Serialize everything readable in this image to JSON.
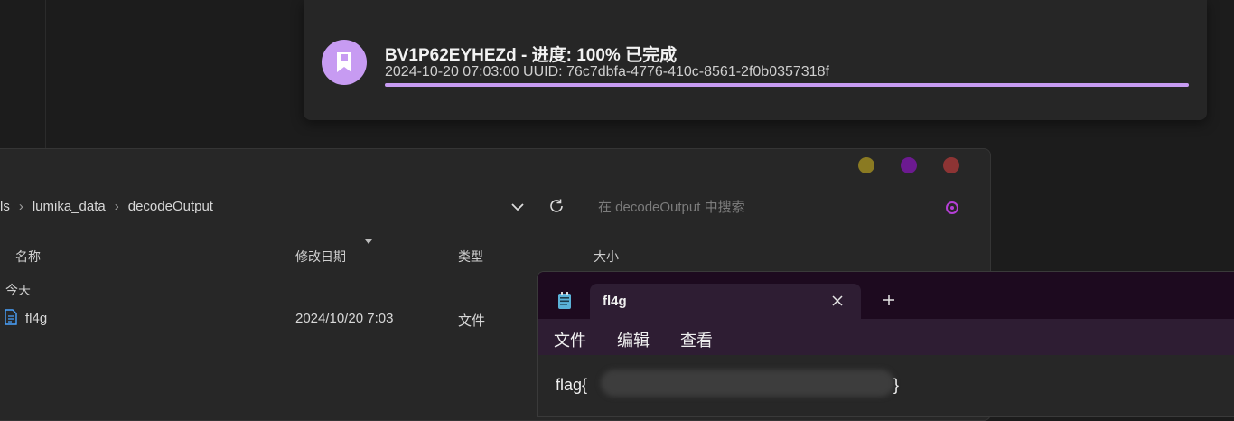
{
  "notification": {
    "title": "BV1P62EYHEZd - 进度: 100% 已完成",
    "subtitle": "2024-10-20 07:03:00 UUID: 76c7dbfa-4776-410c-8561-2f0b0357318f",
    "progress": 1.0,
    "accent_color": "#c79bf2",
    "icon": "bookmark-icon"
  },
  "explorer": {
    "breadcrumb": [
      "ls",
      "lumika_data",
      "decodeOutput"
    ],
    "search_placeholder": "在 decodeOutput 中搜索",
    "columns": {
      "name": "名称",
      "modified": "修改日期",
      "type": "类型",
      "size": "大小"
    },
    "group_label": "今天",
    "rows": [
      {
        "name": "fl4g",
        "modified": "2024/10/20 7:03",
        "type": "文件",
        "size": ""
      }
    ]
  },
  "notepad": {
    "tab_title": "fl4g",
    "menu": [
      "文件",
      "编辑",
      "查看"
    ],
    "content_start": "flag{",
    "content_end": "}"
  }
}
